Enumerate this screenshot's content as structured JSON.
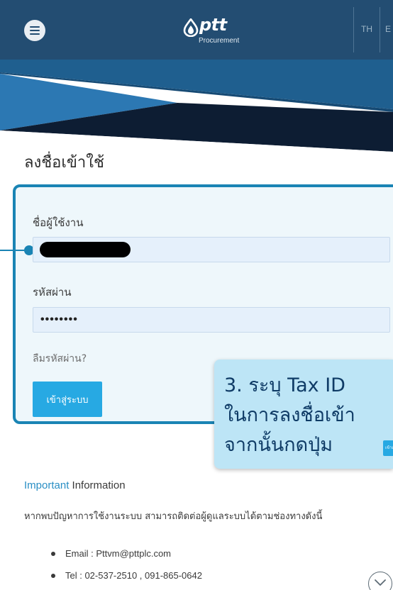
{
  "header": {
    "logo_text": "ptt",
    "logo_subtitle": "Procurement",
    "lang_th": "TH",
    "lang_en": "E"
  },
  "login": {
    "title": "ลงชื่อเข้าใช้",
    "username_label": "ชื่อผู้ใช้งาน",
    "username_value": "",
    "password_label": "รหัสผ่าน",
    "password_value": "••••••••",
    "forgot_link": "ลืมรหัสผ่าน?",
    "submit_label": "เข้าสู่ระบบ"
  },
  "callout": {
    "line1": "3. ระบุ Tax ID",
    "line2": "ในการลงชื่อเข้า",
    "line3": "จากนั้นกดปุ่ม",
    "button_text": "เข้าสู่ระบบ"
  },
  "info": {
    "title_accent": "Important",
    "title_rest": " Information",
    "text": "หากพบปัญหาการใช้งานระบบ สามารถติดต่อผู้ดูแลระบบได้ตามช่องทางดังนี้",
    "email": "Email : Pttvm@pttplc.com",
    "tel": "Tel : 02-537-2510 , 091-865-0642"
  },
  "colors": {
    "header_bg": "#234d72",
    "accent": "#27a9e3",
    "panel_border": "#1a84b4",
    "panel_bg": "#eef7fb",
    "callout_bg": "#bde5f6"
  },
  "icons": [
    "hamburger-menu-icon",
    "ptt-logo-icon",
    "chevron-down-icon"
  ]
}
